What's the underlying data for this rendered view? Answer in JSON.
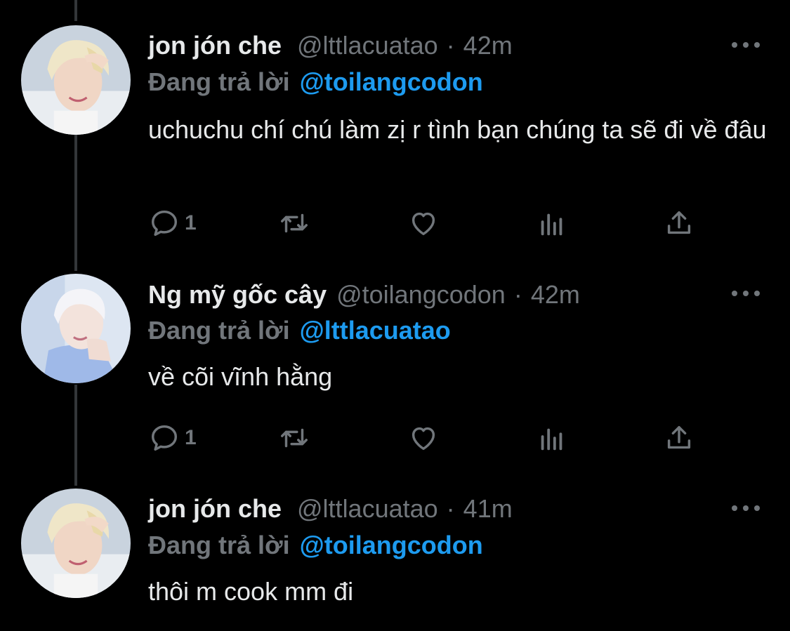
{
  "tweets": [
    {
      "author": "jon jón che",
      "handle": "@lttlacuatao",
      "separator": "·",
      "time": "42m",
      "reply_prefix": "Đang trả lời",
      "reply_to": "@toilangcodon",
      "text": "uchuchu chí chú làm zị r tình bạn chúng ta sẽ đi về đâu",
      "reply_count": "1",
      "avatar_style": "blonde"
    },
    {
      "author": "Ng mỹ gốc cây",
      "handle": "@toilangcodon",
      "separator": "·",
      "time": "42m",
      "reply_prefix": "Đang trả lời",
      "reply_to": "@lttlacuatao",
      "text": "về cõi vĩnh hằng",
      "reply_count": "1",
      "avatar_style": "white-hair"
    },
    {
      "author": "jon jón che",
      "handle": "@lttlacuatao",
      "separator": "·",
      "time": "41m",
      "reply_prefix": "Đang trả lời",
      "reply_to": "@toilangcodon",
      "text": "thôi m cook mm đi",
      "reply_count": "",
      "avatar_style": "blonde"
    }
  ],
  "icons": [
    "reply-icon",
    "retweet-icon",
    "like-icon",
    "views-icon",
    "share-icon",
    "more-icon"
  ],
  "colors": {
    "background": "#000000",
    "primary_text": "#e7e9ea",
    "secondary_text": "#71767b",
    "accent": "#1d9bf0",
    "thread_line": "#333639"
  }
}
